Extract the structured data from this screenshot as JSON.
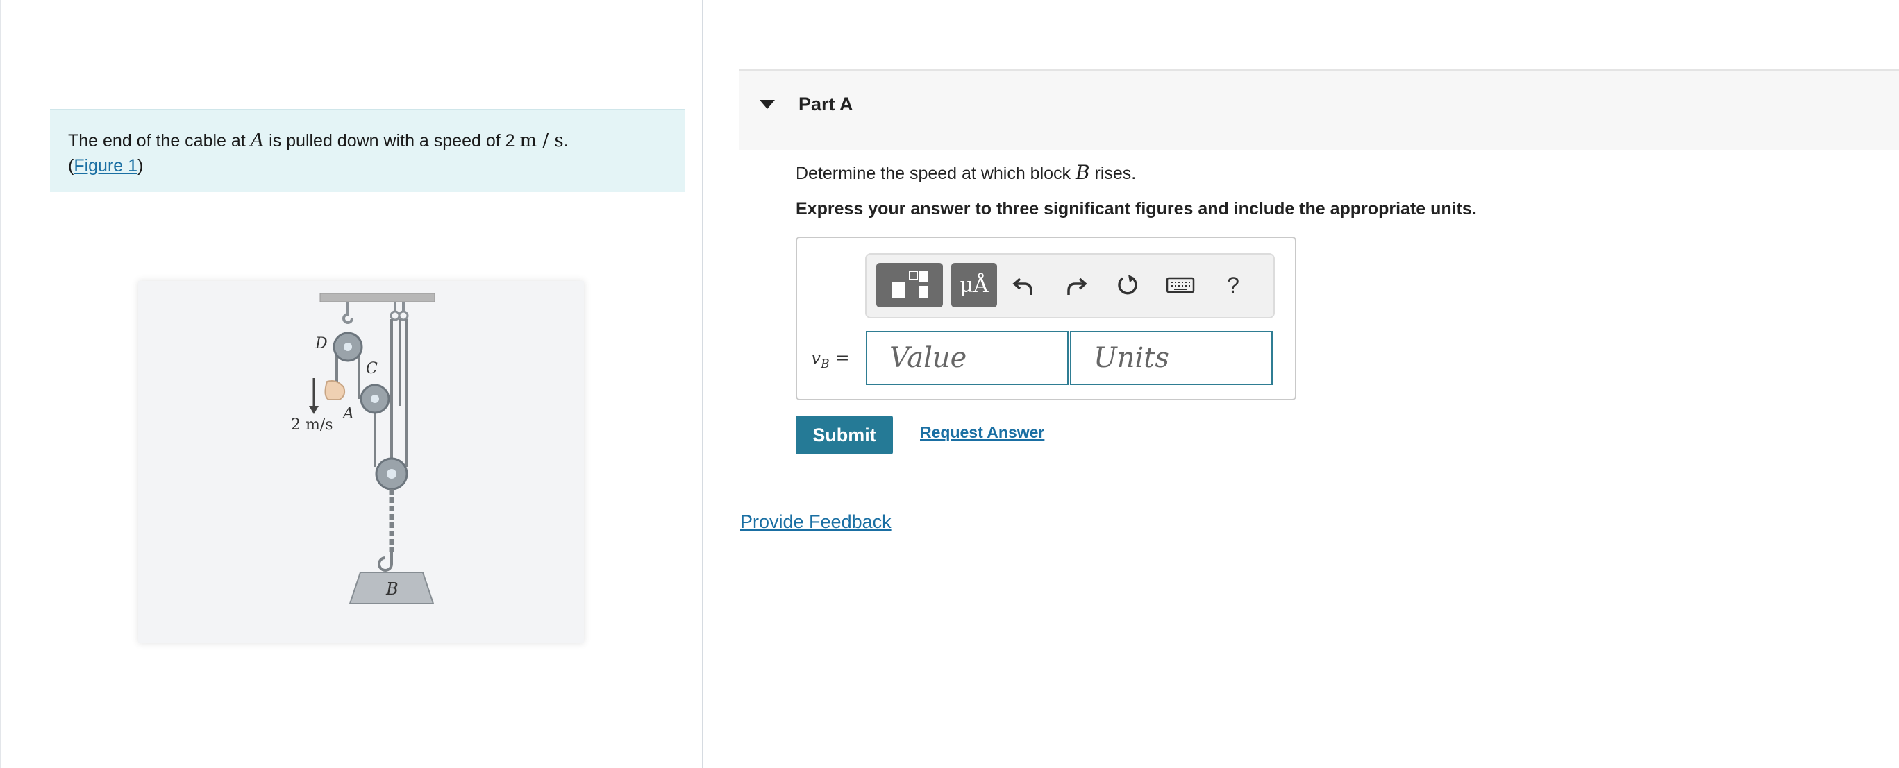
{
  "problem": {
    "text_before": "The end of the cable at ",
    "var_a": "A",
    "text_middle": " is pulled down with a speed of ",
    "speed_value": "2",
    "speed_unit": "m / s",
    "text_end": ".",
    "figure_open": "(",
    "figure_link": "Figure 1",
    "figure_close": ")"
  },
  "figure": {
    "label_d": "D",
    "label_c": "C",
    "label_a": "A",
    "label_b": "B",
    "speed_label": "2 m/s"
  },
  "part": {
    "title": "Part A",
    "question_before": "Determine the speed at which block ",
    "question_var": "B",
    "question_after": " rises.",
    "instruction": "Express your answer to three significant figures and include the appropriate units."
  },
  "toolbar": {
    "units_label": "μÅ",
    "help_label": "?",
    "icons": [
      "templates-icon",
      "units-icon",
      "undo-icon",
      "redo-icon",
      "reset-icon",
      "keyboard-icon",
      "help-icon"
    ]
  },
  "answer": {
    "var_main": "v",
    "var_sub": "B",
    "equals": " =",
    "value_placeholder": "Value",
    "units_placeholder": "Units"
  },
  "actions": {
    "submit_label": "Submit",
    "request_label": "Request Answer",
    "feedback_label": "Provide Feedback"
  },
  "colors": {
    "accent": "#257a96",
    "link": "#1a6fa3",
    "intro_bg": "#e4f4f6"
  }
}
